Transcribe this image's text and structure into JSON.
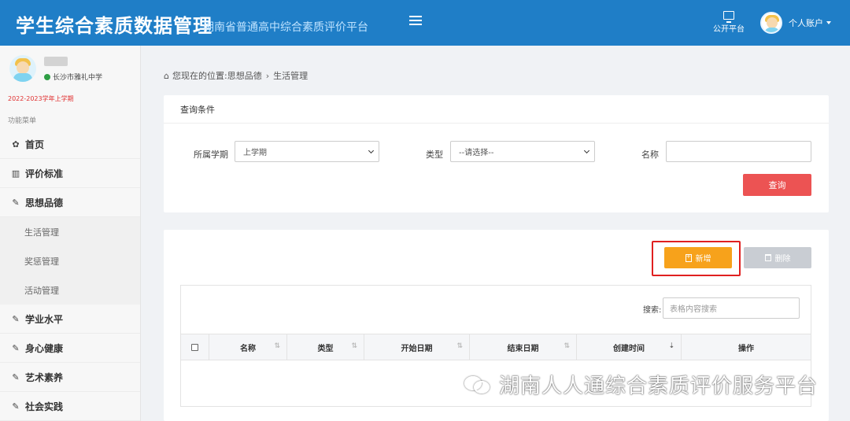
{
  "header": {
    "title": "学生综合素质数据管理",
    "subtitle": "湖南省普通高中综合素质评价平台",
    "public_platform_label": "公开平台",
    "account_label": "个人账户"
  },
  "sidebar": {
    "school": "长沙市雅礼中学",
    "term": "2022-2023学年上学期",
    "menu_title": "功能菜单",
    "items": [
      {
        "label": "首页",
        "icon": "dashboard-icon"
      },
      {
        "label": "评价标准",
        "icon": "map-icon"
      },
      {
        "label": "思想品德",
        "icon": "edit-icon"
      },
      {
        "label": "生活管理",
        "sub": true
      },
      {
        "label": "奖惩管理",
        "sub": true
      },
      {
        "label": "活动管理",
        "sub": true
      },
      {
        "label": "学业水平",
        "icon": "edit-icon"
      },
      {
        "label": "身心健康",
        "icon": "edit-icon"
      },
      {
        "label": "艺术素养",
        "icon": "edit-icon"
      },
      {
        "label": "社会实践",
        "icon": "edit-icon"
      }
    ]
  },
  "breadcrumb": {
    "prefix": "您现在的位置:",
    "parent": "思想品德",
    "current": "生活管理"
  },
  "query": {
    "title": "查询条件",
    "term_label": "所属学期",
    "term_value": "上学期",
    "type_label": "类型",
    "type_value": "--请选择--",
    "name_label": "名称",
    "name_value": "",
    "query_button": "查询"
  },
  "list": {
    "add_button": "新增",
    "delete_button": "删除",
    "search_label": "搜索:",
    "search_placeholder": "表格内容搜索",
    "columns": [
      "名称",
      "类型",
      "开始日期",
      "结束日期",
      "创建时间",
      "操作"
    ]
  },
  "watermark": "湖南人人通综合素质评价服务平台",
  "colors": {
    "header_bg": "#1f7ec7",
    "query_button": "#ec5353",
    "add_button": "#f7a21b",
    "delete_button": "#c9cdd3",
    "highlight_border": "#e02020",
    "term_text": "#e03030"
  }
}
